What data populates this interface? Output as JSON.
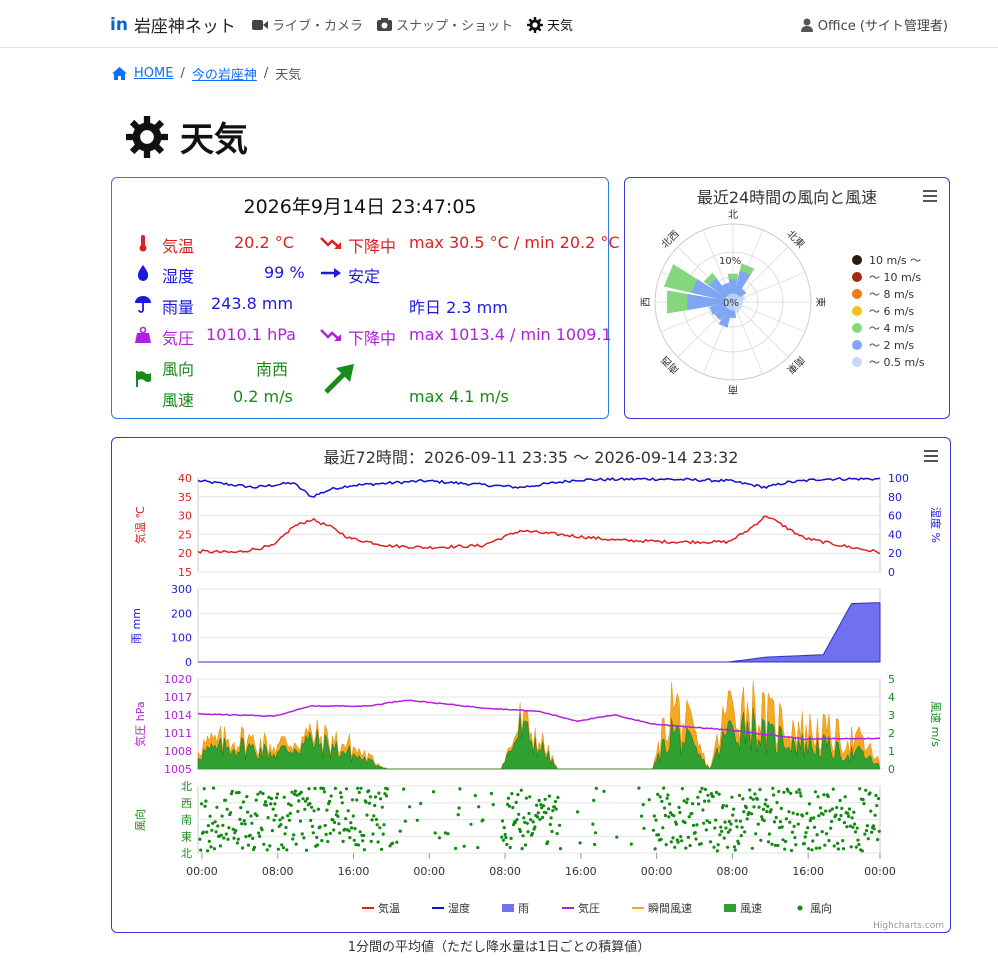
{
  "nav": {
    "brand": "岩座神ネット",
    "brand_logo": "in",
    "items": [
      {
        "label": "ライブ・カメラ",
        "icon": "video-camera-icon"
      },
      {
        "label": "スナップ・ショット",
        "icon": "camera-icon"
      },
      {
        "label": "天気",
        "icon": "gear-icon"
      }
    ],
    "user": "Office (サイト管理者)"
  },
  "breadcrumb": {
    "home": "HOME",
    "parent": "今の岩座神",
    "current": "天気",
    "sep": "/"
  },
  "page_title": "天気",
  "current": {
    "datetime": "2026年9月14日 23:47:05",
    "temp": {
      "label": "気温",
      "value": "20.2 °C",
      "trend": "下降中",
      "range": "max 30.5 °C / min 20.2 °C",
      "color": "#e02020"
    },
    "humidity": {
      "label": "湿度",
      "value": "99 %",
      "trend": "安定",
      "color": "#1a1ae0"
    },
    "rain": {
      "label": "雨量",
      "value": "243.8 mm",
      "yesterday": "昨日 2.3 mm",
      "color": "#1a1ae0"
    },
    "pressure": {
      "label": "気圧",
      "value": "1010.1 hPa",
      "trend": "下降中",
      "range": "max 1013.4 / min 1009.1",
      "color": "#b020e0"
    },
    "wind_dir": {
      "label": "風向",
      "value": "南西",
      "color": "#1a8a1a"
    },
    "wind_speed": {
      "label": "風速",
      "value": "0.2 m/s",
      "max": "max 4.1 m/s",
      "color": "#1a8a1a"
    }
  },
  "rose": {
    "title": "最近24時間の風向と風速",
    "directions": [
      "北",
      "北東",
      "東",
      "南東",
      "南",
      "南西",
      "西",
      "北西"
    ],
    "rings": [
      "0%",
      "10%"
    ],
    "legend": [
      {
        "label": "10 m/s ～",
        "color": "#2b1b0e"
      },
      {
        "label": "～ 10 m/s",
        "color": "#a02a12"
      },
      {
        "label": "～ 8 m/s",
        "color": "#f07a14"
      },
      {
        "label": "～ 6 m/s",
        "color": "#f2c21a"
      },
      {
        "label": "～ 4 m/s",
        "color": "#86d77c"
      },
      {
        "label": "～ 2 m/s",
        "color": "#7fa6f2"
      },
      {
        "label": "～ 0.5 m/s",
        "color": "#c6d8f5"
      }
    ]
  },
  "chart": {
    "title": "最近72時間：2026-09-11 23:35 ～ 2026-09-14 23:32",
    "x_ticks": [
      "00:00",
      "08:00",
      "16:00",
      "00:00",
      "08:00",
      "16:00",
      "00:00",
      "08:00",
      "16:00",
      "00:00"
    ],
    "temp_axis": {
      "label": "気温 ℃",
      "ticks": [
        "40",
        "35",
        "30",
        "25",
        "20",
        "15"
      ]
    },
    "hum_axis": {
      "label": "湿度 %",
      "ticks": [
        "100",
        "80",
        "60",
        "40",
        "20",
        "0"
      ]
    },
    "rain_axis": {
      "label": "雨 mm",
      "ticks": [
        "300",
        "200",
        "100",
        "0"
      ]
    },
    "pres_axis": {
      "label": "気圧 hPa",
      "ticks": [
        "1020",
        "1017",
        "1014",
        "1011",
        "1008",
        "1005"
      ]
    },
    "wind_axis": {
      "label": "風速 m/s",
      "ticks": [
        "5",
        "4",
        "3",
        "2",
        "1",
        "0"
      ]
    },
    "dir_axis": {
      "label": "風向",
      "ticks": [
        "北",
        "西",
        "南",
        "東",
        "北"
      ]
    },
    "legend": [
      {
        "label": "気温",
        "color": "#e02020",
        "type": "line"
      },
      {
        "label": "湿度",
        "color": "#1010d0",
        "type": "line"
      },
      {
        "label": "雨",
        "color": "#7070f0",
        "type": "area"
      },
      {
        "label": "気圧",
        "color": "#b020e0",
        "type": "line"
      },
      {
        "label": "瞬間風速",
        "color": "#f5a820",
        "type": "line"
      },
      {
        "label": "風速",
        "color": "#30a030",
        "type": "area"
      },
      {
        "label": "風向",
        "color": "#108a10",
        "type": "dot"
      }
    ],
    "credit": "Highcharts.com"
  },
  "chart_data": {
    "type": "line",
    "x_unit": "hours since 2026-09-11 23:35",
    "series": [
      {
        "name": "気温",
        "points": [
          [
            0,
            20.5
          ],
          [
            4,
            20.2
          ],
          [
            8,
            22
          ],
          [
            10,
            27
          ],
          [
            12,
            29
          ],
          [
            14,
            27
          ],
          [
            16,
            24
          ],
          [
            20,
            22
          ],
          [
            24,
            21.5
          ],
          [
            30,
            22
          ],
          [
            34,
            26
          ],
          [
            38,
            25
          ],
          [
            44,
            23.5
          ],
          [
            50,
            23
          ],
          [
            56,
            23
          ],
          [
            58,
            26
          ],
          [
            60,
            30
          ],
          [
            62,
            27
          ],
          [
            64,
            24
          ],
          [
            68,
            22
          ],
          [
            72,
            20.2
          ]
        ]
      },
      {
        "name": "湿度",
        "points": [
          [
            0,
            97
          ],
          [
            6,
            90
          ],
          [
            10,
            95
          ],
          [
            12,
            80
          ],
          [
            14,
            88
          ],
          [
            16,
            92
          ],
          [
            24,
            97
          ],
          [
            34,
            90
          ],
          [
            40,
            98
          ],
          [
            48,
            99
          ],
          [
            56,
            97
          ],
          [
            60,
            90
          ],
          [
            62,
            95
          ],
          [
            66,
            99
          ],
          [
            72,
            99
          ]
        ]
      },
      {
        "name": "雨",
        "points": [
          [
            0,
            0
          ],
          [
            56,
            0
          ],
          [
            60,
            20
          ],
          [
            66,
            30
          ],
          [
            69,
            240
          ],
          [
            72,
            243.8
          ]
        ]
      },
      {
        "name": "気圧",
        "points": [
          [
            0,
            1014.2
          ],
          [
            8,
            1013.8
          ],
          [
            12,
            1015.5
          ],
          [
            18,
            1015.5
          ],
          [
            22,
            1016.5
          ],
          [
            30,
            1015.2
          ],
          [
            36,
            1014.6
          ],
          [
            40,
            1013.0
          ],
          [
            44,
            1014.0
          ],
          [
            48,
            1012.5
          ],
          [
            56,
            1011.5
          ],
          [
            64,
            1010.0
          ],
          [
            72,
            1010.1
          ]
        ]
      },
      {
        "name": "風速",
        "points": [
          [
            0,
            1.0
          ],
          [
            4,
            1.5
          ],
          [
            8,
            1.0
          ],
          [
            12,
            1.8
          ],
          [
            16,
            1.0
          ],
          [
            20,
            0
          ],
          [
            32,
            0
          ],
          [
            34,
            2.5
          ],
          [
            36,
            1.5
          ],
          [
            38,
            0
          ],
          [
            48,
            0
          ],
          [
            50,
            2.5
          ],
          [
            52,
            1.5
          ],
          [
            54,
            0
          ],
          [
            56,
            2.5
          ],
          [
            58,
            3.0
          ],
          [
            60,
            2.0
          ],
          [
            62,
            2.0
          ],
          [
            64,
            1.5
          ],
          [
            66,
            1.5
          ],
          [
            68,
            1.0
          ],
          [
            70,
            1.0
          ],
          [
            72,
            0.2
          ]
        ]
      },
      {
        "name": "瞬間風速",
        "points": [
          [
            0,
            1.5
          ],
          [
            4,
            2.0
          ],
          [
            8,
            1.5
          ],
          [
            12,
            2.2
          ],
          [
            16,
            1.5
          ],
          [
            20,
            0
          ],
          [
            32,
            0
          ],
          [
            34,
            3.0
          ],
          [
            36,
            2.0
          ],
          [
            38,
            0
          ],
          [
            48,
            0
          ],
          [
            50,
            4.3
          ],
          [
            52,
            2.5
          ],
          [
            54,
            0
          ],
          [
            56,
            4.1
          ],
          [
            58,
            4.2
          ],
          [
            60,
            3.2
          ],
          [
            62,
            3.0
          ],
          [
            64,
            2.5
          ],
          [
            66,
            2.4
          ],
          [
            68,
            2.0
          ],
          [
            70,
            1.8
          ],
          [
            72,
            0.5
          ]
        ]
      }
    ]
  },
  "footer_note": "1分間の平均値（ただし降水量は1日ごとの積算値）"
}
